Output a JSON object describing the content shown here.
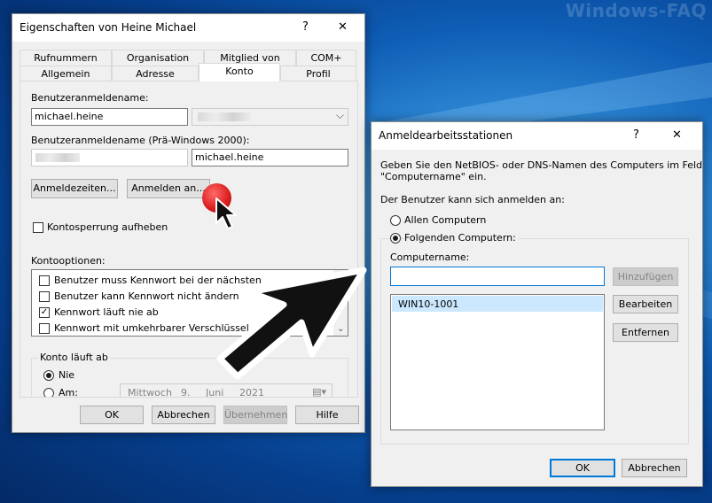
{
  "watermark": "Windows-FAQ",
  "props_dialog": {
    "title": "Eigenschaften von Heine Michael",
    "help": "?",
    "close": "✕",
    "tabs_row1": [
      "Rufnummern",
      "Organisation",
      "Mitglied von",
      "COM+"
    ],
    "tabs_row2": [
      "Allgemein",
      "Adresse",
      "Konto",
      "Profil"
    ],
    "active_tab": "Konto",
    "logon_name_label": "Benutzeranmeldename:",
    "logon_name_value": "michael.heine",
    "pre2000_label": "Benutzeranmeldename (Prä-Windows 2000):",
    "pre2000_value": "michael.heine",
    "logon_hours_button": "Anmeldezeiten...",
    "logon_to_button": "Anmelden an...",
    "unlock_label": "Kontosperrung aufheben",
    "account_options_label": "Kontooptionen:",
    "account_options": [
      {
        "label": "Benutzer muss Kennwort bei der nächsten",
        "checked": false
      },
      {
        "label": "Benutzer kann Kennwort nicht ändern",
        "checked": false
      },
      {
        "label": "Kennwort läuft nie ab",
        "checked": true
      },
      {
        "label": "Kennwort mit umkehrbarer Verschlüssel",
        "checked": false
      }
    ],
    "expires_group": "Konto läuft ab",
    "expires_never": "Nie",
    "expires_on": "Am:",
    "date_weekday": "Mittwoch",
    "date_day": "9.",
    "date_month": "Juni",
    "date_year": "2021",
    "ok": "OK",
    "cancel": "Abbrechen",
    "apply": "Übernehmen",
    "help_button": "Hilfe"
  },
  "ws_dialog": {
    "title": "Anmeldearbeitsstationen",
    "help": "?",
    "close": "✕",
    "description_line1": "Geben Sie den NetBIOS- oder DNS-Namen des Computers im Feld",
    "description_line2": "\"Computername\" ein.",
    "can_logon_label": "Der Benutzer kann sich anmelden an:",
    "option_all": "Allen Computern",
    "option_following": "Folgenden Computern:",
    "computername_label": "Computername:",
    "computername_value": "",
    "add_button": "Hinzufügen",
    "edit_button": "Bearbeiten",
    "remove_button": "Entfernen",
    "computers": [
      "WIN10-1001"
    ],
    "ok": "OK",
    "cancel": "Abbrechen"
  },
  "icons": [
    "close-icon",
    "help-icon",
    "chevron-down-icon",
    "check-icon",
    "calendar-icon",
    "mouse-pointer-icon",
    "big-arrow-icon"
  ]
}
